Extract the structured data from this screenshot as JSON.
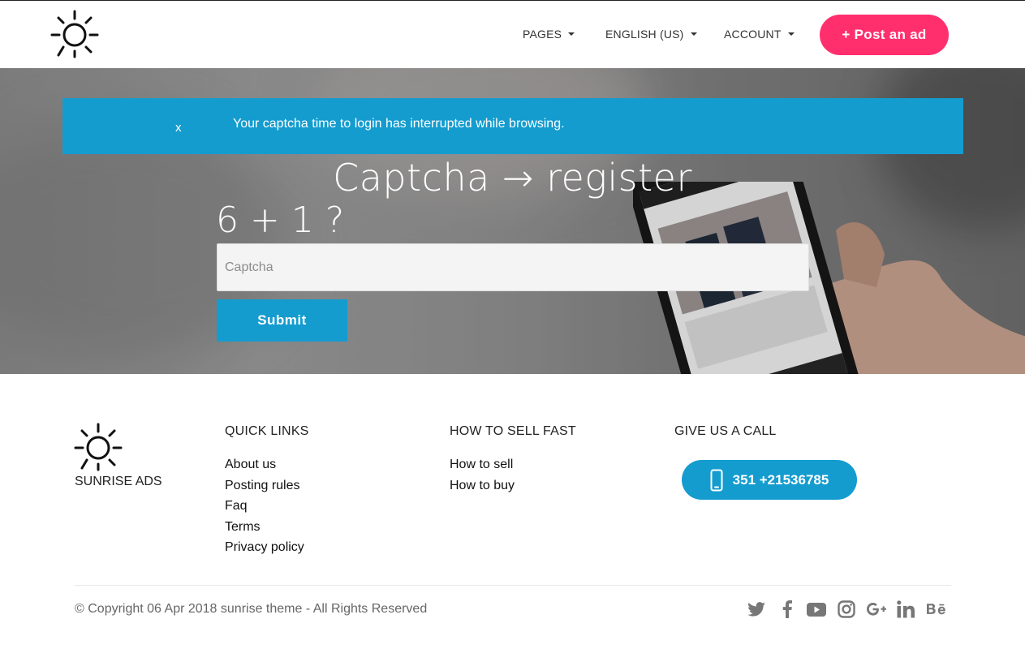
{
  "header": {
    "logo_icon": "sun-icon",
    "nav": [
      {
        "label": "PAGES"
      },
      {
        "label": "ENGLISH (US)"
      },
      {
        "label": "ACCOUNT"
      }
    ],
    "post_ad_label": "+ Post an ad",
    "post_ad_color": "#ff2f6e"
  },
  "alert": {
    "close_label": "x",
    "message": "Your captcha time to login has interrupted while browsing.",
    "color": "#149ccf"
  },
  "hero": {
    "title": "Captcha → register",
    "question": "6 + 1 ?",
    "input_placeholder": "Captcha",
    "input_value": "",
    "submit_label": "Submit"
  },
  "footer": {
    "brand": "SUNRISE ADS",
    "columns": [
      {
        "heading": "QUICK LINKS",
        "links": [
          "About us",
          "Posting rules",
          "Faq",
          "Terms",
          "Privacy policy"
        ]
      },
      {
        "heading": "HOW TO SELL FAST",
        "links": [
          "How to sell",
          "How to buy"
        ]
      },
      {
        "heading": "GIVE US A CALL",
        "links": []
      }
    ],
    "phone_label": "351 +21536785",
    "copyright": "© Copyright 06 Apr 2018 sunrise theme - All Rights Reserved",
    "social": [
      "twitter-icon",
      "facebook-icon",
      "youtube-icon",
      "instagram-icon",
      "google-plus-icon",
      "linkedin-icon",
      "behance-icon"
    ]
  }
}
